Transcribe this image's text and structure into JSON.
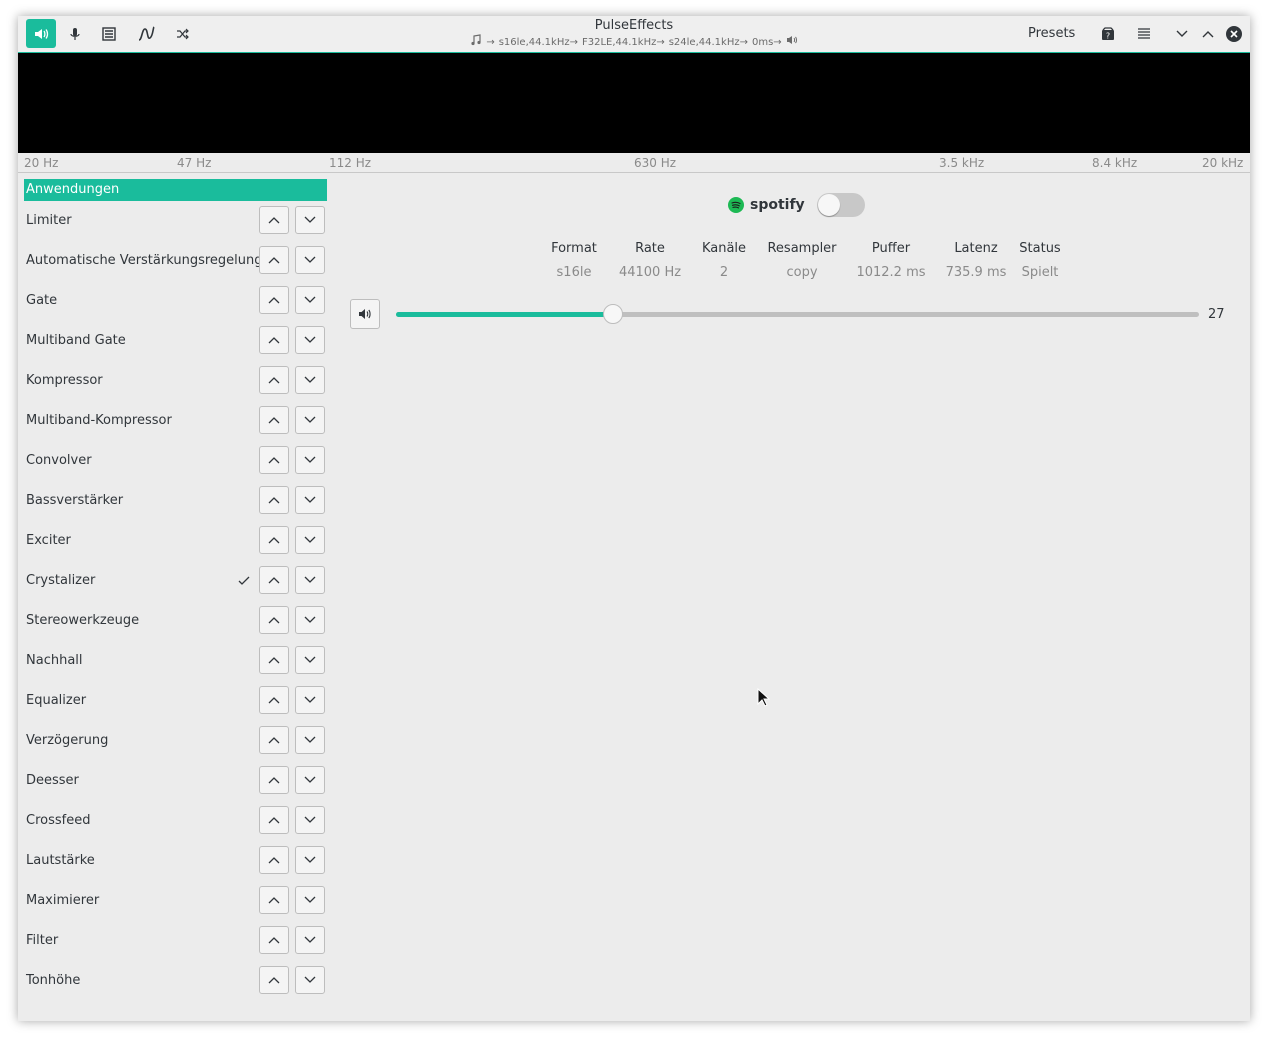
{
  "window": {
    "title": "PulseEffects",
    "pipeline": [
      "s16le,44.1kHz→",
      "F32LE,44.1kHz→",
      "s24le,44.1kHz→",
      "0ms→"
    ],
    "presets_label": "Presets",
    "accent": "#1abc9c"
  },
  "toolbar": {
    "icons": [
      "speaker-icon",
      "microphone-icon",
      "list-icon",
      "curve-icon",
      "shuffle-icon"
    ],
    "active": "speaker-icon"
  },
  "spectrum": {
    "freq_labels": [
      "20 Hz",
      "47 Hz",
      "112 Hz",
      "630 Hz",
      "3.5 kHz",
      "8.4 kHz",
      "20 kHz"
    ]
  },
  "sidebar": {
    "header": "Anwendungen",
    "items": [
      {
        "label": "Limiter",
        "checked": false
      },
      {
        "label": "Automatische Verstärkungsregelung",
        "checked": false
      },
      {
        "label": "Gate",
        "checked": false
      },
      {
        "label": "Multiband Gate",
        "checked": false
      },
      {
        "label": "Kompressor",
        "checked": false
      },
      {
        "label": "Multiband-Kompressor",
        "checked": false
      },
      {
        "label": "Convolver",
        "checked": false
      },
      {
        "label": "Bassverstärker",
        "checked": false
      },
      {
        "label": "Exciter",
        "checked": false
      },
      {
        "label": "Crystalizer",
        "checked": true
      },
      {
        "label": "Stereowerkzeuge",
        "checked": false
      },
      {
        "label": "Nachhall",
        "checked": false
      },
      {
        "label": "Equalizer",
        "checked": false
      },
      {
        "label": "Verzögerung",
        "checked": false
      },
      {
        "label": "Deesser",
        "checked": false
      },
      {
        "label": "Crossfeed",
        "checked": false
      },
      {
        "label": "Lautstärke",
        "checked": false
      },
      {
        "label": "Maximierer",
        "checked": false
      },
      {
        "label": "Filter",
        "checked": false
      },
      {
        "label": "Tonhöhe",
        "checked": false
      }
    ]
  },
  "app": {
    "name": "spotify",
    "enabled": false,
    "brand_color": "#1db954",
    "columns": [
      {
        "header": "Format",
        "value": "s16le"
      },
      {
        "header": "Rate",
        "value": "44100 Hz"
      },
      {
        "header": "Kanäle",
        "value": "2"
      },
      {
        "header": "Resampler",
        "value": "copy"
      },
      {
        "header": "Puffer",
        "value": "1012.2 ms"
      },
      {
        "header": "Latenz",
        "value": "735.9 ms"
      },
      {
        "header": "Status",
        "value": "Spielt"
      }
    ],
    "volume": 27
  }
}
